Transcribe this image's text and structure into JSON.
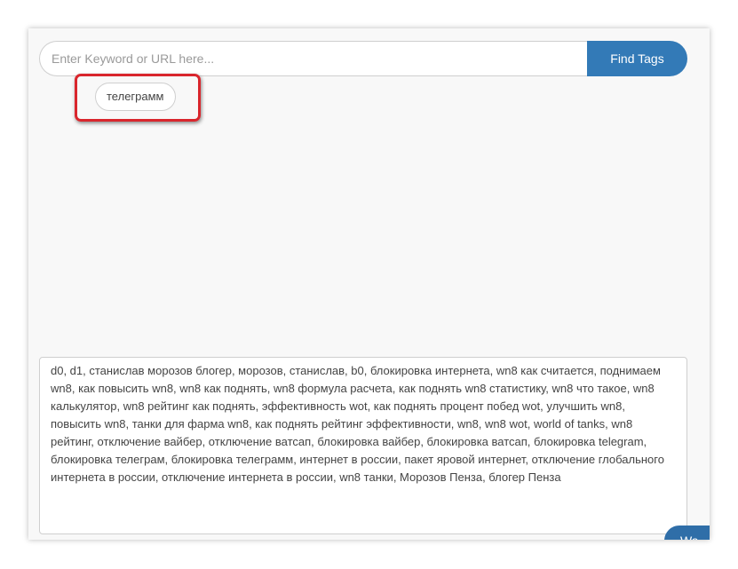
{
  "search": {
    "placeholder": "Enter Keyword or URL here...",
    "value": ""
  },
  "find_button": {
    "label": "Find Tags"
  },
  "suggested_tags": [
    "телеграмм"
  ],
  "tags_output": {
    "value": "d0, d1, станислав морозов блогер, морозов, станислав, b0, блокировка интернета, wn8 как считается, поднимаем wn8, как повысить wn8, wn8 как поднять, wn8 формула расчета, как поднять wn8 статистику, wn8 что такое, wn8 калькулятор, wn8 рейтинг как поднять, эффективность wot, как поднять процент побед wot, улучшить wn8, повысить wn8, танки для фарма wn8, как поднять рейтинг эффективности, wn8, wn8 wot, world of tanks, wn8 рейтинг, отключение вайбер, отключение ватсап, блокировка вайбер, блокировка ватсап, блокировка telegram, блокировка телеграм, блокировка телеграмм, интернет в россии, пакет яровой интернет, отключение глобального интернета в россии, отключение интернета в россии, wn8 танки, Морозов Пенза, блогер Пенза"
  },
  "corner_button": {
    "label": "Wa"
  },
  "colors": {
    "accent": "#337ab7",
    "highlight": "#d9262d",
    "panel_background": "#f8f8f8"
  }
}
